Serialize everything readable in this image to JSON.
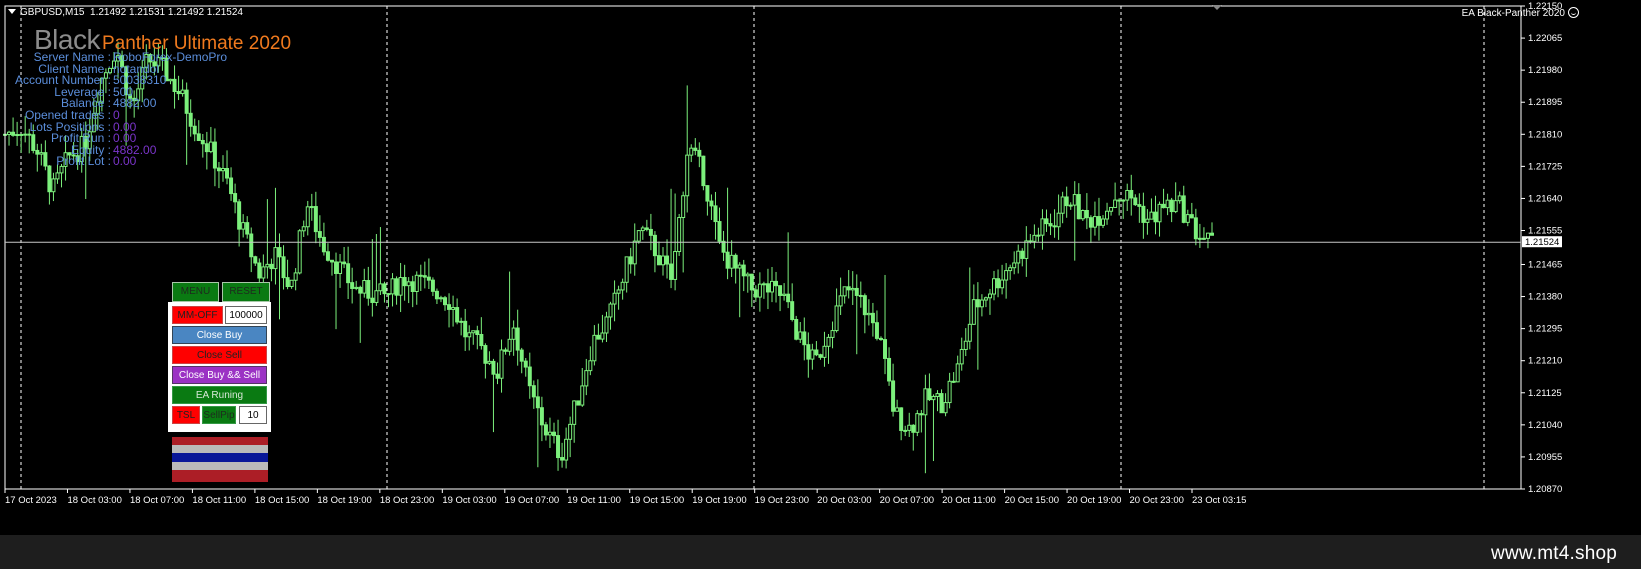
{
  "chart": {
    "symbol": "GBPUSD,M15",
    "ohlc": "1.21492 1.21531 1.21492 1.21524",
    "ea_name": "EA Black-Panther 2020",
    "current_price": "1.21524",
    "current_value": 1.21524,
    "colors": {
      "background": "#000000",
      "candles": "#7cf07c",
      "price_line": "#c8c8c8",
      "grid": "#ffffff"
    }
  },
  "logo": {
    "word1": "Black",
    "word2": "Panther Ultimate 2020"
  },
  "account_info": [
    {
      "label": "Server Name",
      "value": "RoboForex-DemoPro",
      "color": "blue"
    },
    {
      "label": "Client Name",
      "value": "notandol",
      "color": "blue"
    },
    {
      "label": "Account Number",
      "value": "50038310",
      "color": "blue"
    },
    {
      "label": "Leverage",
      "value": "500",
      "color": "blue"
    },
    {
      "label": "Balance",
      "value": "4882.00",
      "color": "blue"
    },
    {
      "label": "Opened trades",
      "value": "0",
      "color": "purple"
    },
    {
      "label": "Lots Positions",
      "value": "0.00",
      "color": "purple"
    },
    {
      "label": "Profit Run",
      "value": "0.00",
      "color": "purple"
    },
    {
      "label": "Equity",
      "value": "4882.00",
      "color": "purple"
    },
    {
      "label": "Profit Lot",
      "value": "0.00",
      "color": "purple"
    }
  ],
  "panel": {
    "menu": "MENU",
    "reset": "RESET",
    "mm_off": "MM-OFF",
    "mm_value": "100000",
    "close_buy": "Close Buy",
    "close_sell": "Close Sell",
    "close_both": "Close Buy && Sell",
    "ea_status": "EA Runing",
    "tsl": "TSL",
    "sellpip": "SellPip",
    "pip_value": "10"
  },
  "chart_data": {
    "type": "candlestick",
    "price_labels": [
      "1.22150",
      "1.22065",
      "1.21980",
      "1.21895",
      "1.21810",
      "1.21725",
      "1.21640",
      "1.21555",
      "1.21465",
      "1.21380",
      "1.21295",
      "1.21210",
      "1.21125",
      "1.21040",
      "1.20955",
      "1.20870"
    ],
    "ylim": [
      1.2087,
      1.2215
    ],
    "time_labels": [
      "17 Oct 2023",
      "18 Oct 03:00",
      "18 Oct 07:00",
      "18 Oct 11:00",
      "18 Oct 15:00",
      "18 Oct 19:00",
      "18 Oct 23:00",
      "19 Oct 03:00",
      "19 Oct 07:00",
      "19 Oct 11:00",
      "19 Oct 15:00",
      "19 Oct 19:00",
      "19 Oct 23:00",
      "20 Oct 03:00",
      "20 Oct 07:00",
      "20 Oct 11:00",
      "20 Oct 15:00",
      "20 Oct 19:00",
      "20 Oct 23:00",
      "23 Oct 03:15"
    ],
    "close_path": [
      1.2181,
      1.2183,
      1.2177,
      1.2166,
      1.2175,
      1.2178,
      1.2195,
      1.2204,
      1.2188,
      1.2201,
      1.2198,
      1.2192,
      1.2183,
      1.2176,
      1.2168,
      1.2155,
      1.2144,
      1.2149,
      1.214,
      1.2163,
      1.2152,
      1.2146,
      1.214,
      1.2139,
      1.2138,
      1.2143,
      1.2142,
      1.214,
      1.2137,
      1.2128,
      1.2124,
      1.2118,
      1.2131,
      1.2113,
      1.2103,
      1.2096,
      1.211,
      1.2126,
      1.2132,
      1.2144,
      1.2156,
      1.215,
      1.2142,
      1.2178,
      1.217,
      1.2151,
      1.2145,
      1.214,
      1.214,
      1.2138,
      1.2127,
      1.212,
      1.2131,
      1.214,
      1.2136,
      1.2128,
      1.2107,
      1.2103,
      1.2111,
      1.211,
      1.2119,
      1.2135,
      1.214,
      1.2145,
      1.215,
      1.2155,
      1.2158,
      1.2165,
      1.2158,
      1.216,
      1.2165,
      1.2164,
      1.2158,
      1.2162,
      1.2162,
      1.2155,
      1.2152
    ]
  }
}
